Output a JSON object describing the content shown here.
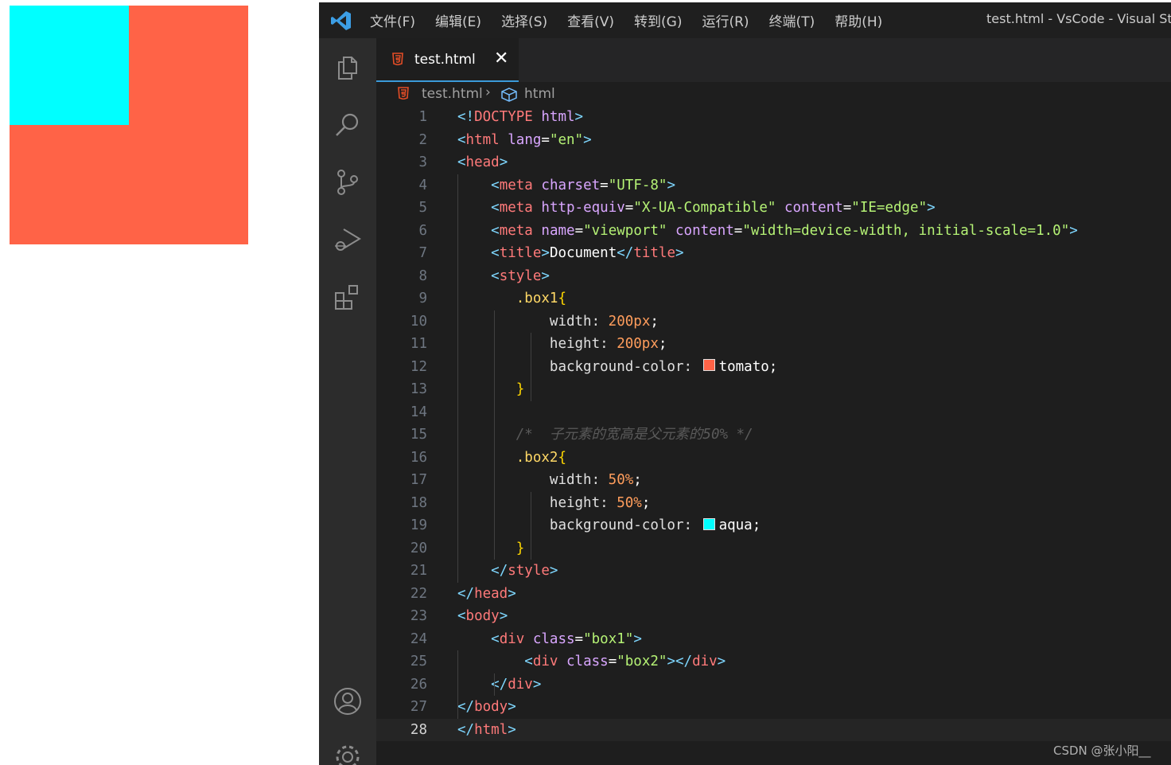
{
  "preview": {
    "box1_color": "#ff6347",
    "box2_color": "#00ffff"
  },
  "titlebar": {
    "logo_icon": "vscode-logo-icon",
    "menus": [
      "文件(F)",
      "编辑(E)",
      "选择(S)",
      "查看(V)",
      "转到(G)",
      "运行(R)",
      "终端(T)",
      "帮助(H)"
    ],
    "window_title": "test.html - VsCode - Visual St"
  },
  "activity_bar": {
    "icons": [
      "explorer-icon",
      "search-icon",
      "source-control-icon",
      "run-debug-icon",
      "extensions-icon",
      "accounts-icon",
      "settings-gear-icon"
    ]
  },
  "tab": {
    "label": "test.html",
    "close": "✕"
  },
  "breadcrumb": {
    "file": "test.html",
    "separator": "›",
    "symbol": "html"
  },
  "editor": {
    "current_line": 28,
    "lines": [
      {
        "n": "1"
      },
      {
        "n": "2"
      },
      {
        "n": "3"
      },
      {
        "n": "4"
      },
      {
        "n": "5"
      },
      {
        "n": "6"
      },
      {
        "n": "7"
      },
      {
        "n": "8"
      },
      {
        "n": "9"
      },
      {
        "n": "10"
      },
      {
        "n": "11"
      },
      {
        "n": "12"
      },
      {
        "n": "13"
      },
      {
        "n": "14"
      },
      {
        "n": "15"
      },
      {
        "n": "16"
      },
      {
        "n": "17"
      },
      {
        "n": "18"
      },
      {
        "n": "19"
      },
      {
        "n": "20"
      },
      {
        "n": "21"
      },
      {
        "n": "22"
      },
      {
        "n": "23"
      },
      {
        "n": "24"
      },
      {
        "n": "25"
      },
      {
        "n": "26"
      },
      {
        "n": "27"
      },
      {
        "n": "28"
      }
    ],
    "code": [
      [
        [
          "punct",
          "<!"
        ],
        [
          "doctype",
          "DOCTYPE"
        ],
        [
          "text",
          " "
        ],
        [
          "attr",
          "html"
        ],
        [
          "punct",
          ">"
        ]
      ],
      [
        [
          "punct",
          "<"
        ],
        [
          "tag",
          "html"
        ],
        [
          "text",
          " "
        ],
        [
          "attr",
          "lang"
        ],
        [
          "text",
          "="
        ],
        [
          "str",
          "\"en\""
        ],
        [
          "punct",
          ">"
        ]
      ],
      [
        [
          "punct",
          "<"
        ],
        [
          "tag",
          "head"
        ],
        [
          "punct",
          ">"
        ]
      ],
      [
        [
          "text",
          "    "
        ],
        [
          "punct",
          "<"
        ],
        [
          "tag",
          "meta"
        ],
        [
          "text",
          " "
        ],
        [
          "attr",
          "charset"
        ],
        [
          "text",
          "="
        ],
        [
          "str",
          "\"UTF-8\""
        ],
        [
          "punct",
          ">"
        ]
      ],
      [
        [
          "text",
          "    "
        ],
        [
          "punct",
          "<"
        ],
        [
          "tag",
          "meta"
        ],
        [
          "text",
          " "
        ],
        [
          "attr",
          "http-equiv"
        ],
        [
          "text",
          "="
        ],
        [
          "str",
          "\"X-UA-Compatible\""
        ],
        [
          "text",
          " "
        ],
        [
          "attr",
          "content"
        ],
        [
          "text",
          "="
        ],
        [
          "str",
          "\"IE=edge\""
        ],
        [
          "punct",
          ">"
        ]
      ],
      [
        [
          "text",
          "    "
        ],
        [
          "punct",
          "<"
        ],
        [
          "tag",
          "meta"
        ],
        [
          "text",
          " "
        ],
        [
          "attr",
          "name"
        ],
        [
          "text",
          "="
        ],
        [
          "str",
          "\"viewport\""
        ],
        [
          "text",
          " "
        ],
        [
          "attr",
          "content"
        ],
        [
          "text",
          "="
        ],
        [
          "str",
          "\"width=device-width, initial-scale=1.0\""
        ],
        [
          "punct",
          ">"
        ]
      ],
      [
        [
          "text",
          "    "
        ],
        [
          "punct",
          "<"
        ],
        [
          "tag",
          "title"
        ],
        [
          "punct",
          ">"
        ],
        [
          "text",
          "Document"
        ],
        [
          "punct",
          "</"
        ],
        [
          "tag",
          "title"
        ],
        [
          "punct",
          ">"
        ]
      ],
      [
        [
          "text",
          "    "
        ],
        [
          "punct",
          "<"
        ],
        [
          "tag",
          "style"
        ],
        [
          "punct",
          ">"
        ]
      ],
      [
        [
          "text",
          "       "
        ],
        [
          "sel",
          ".box1"
        ],
        [
          "brace",
          "{"
        ]
      ],
      [
        [
          "text",
          "           "
        ],
        [
          "prop",
          "width: "
        ],
        [
          "num",
          "200px"
        ],
        [
          "text",
          ";"
        ]
      ],
      [
        [
          "text",
          "           "
        ],
        [
          "prop",
          "height: "
        ],
        [
          "num",
          "200px"
        ],
        [
          "text",
          ";"
        ]
      ],
      [
        [
          "text",
          "           "
        ],
        [
          "prop",
          "background-color: "
        ],
        [
          "swatch",
          "#ff6347"
        ],
        [
          "val",
          "tomato"
        ],
        [
          "text",
          ";"
        ]
      ],
      [
        [
          "text",
          "       "
        ],
        [
          "brace",
          "}"
        ]
      ],
      [],
      [
        [
          "text",
          "       "
        ],
        [
          "comment",
          "/*  子元素的宽高是父元素的50% */"
        ]
      ],
      [
        [
          "text",
          "       "
        ],
        [
          "sel",
          ".box2"
        ],
        [
          "brace",
          "{"
        ]
      ],
      [
        [
          "text",
          "           "
        ],
        [
          "prop",
          "width: "
        ],
        [
          "num",
          "50%"
        ],
        [
          "text",
          ";"
        ]
      ],
      [
        [
          "text",
          "           "
        ],
        [
          "prop",
          "height: "
        ],
        [
          "num",
          "50%"
        ],
        [
          "text",
          ";"
        ]
      ],
      [
        [
          "text",
          "           "
        ],
        [
          "prop",
          "background-color: "
        ],
        [
          "swatch",
          "#00ffff"
        ],
        [
          "val",
          "aqua"
        ],
        [
          "text",
          ";"
        ]
      ],
      [
        [
          "text",
          "       "
        ],
        [
          "brace",
          "}"
        ]
      ],
      [
        [
          "text",
          "    "
        ],
        [
          "punct",
          "</"
        ],
        [
          "tag",
          "style"
        ],
        [
          "punct",
          ">"
        ]
      ],
      [
        [
          "punct",
          "</"
        ],
        [
          "tag",
          "head"
        ],
        [
          "punct",
          ">"
        ]
      ],
      [
        [
          "punct",
          "<"
        ],
        [
          "tag",
          "body"
        ],
        [
          "punct",
          ">"
        ]
      ],
      [
        [
          "text",
          "    "
        ],
        [
          "punct",
          "<"
        ],
        [
          "tag",
          "div"
        ],
        [
          "text",
          " "
        ],
        [
          "attr",
          "class"
        ],
        [
          "text",
          "="
        ],
        [
          "str",
          "\"box1\""
        ],
        [
          "punct",
          ">"
        ]
      ],
      [
        [
          "text",
          "        "
        ],
        [
          "punct",
          "<"
        ],
        [
          "tag",
          "div"
        ],
        [
          "text",
          " "
        ],
        [
          "attr",
          "class"
        ],
        [
          "text",
          "="
        ],
        [
          "str",
          "\"box2\""
        ],
        [
          "punct",
          "></"
        ],
        [
          "tag",
          "div"
        ],
        [
          "punct",
          ">"
        ]
      ],
      [
        [
          "text",
          "    "
        ],
        [
          "punct",
          "</"
        ],
        [
          "tag",
          "div"
        ],
        [
          "punct",
          ">"
        ]
      ],
      [
        [
          "punct",
          "</"
        ],
        [
          "tag",
          "body"
        ],
        [
          "punct",
          ">"
        ]
      ],
      [
        [
          "punct",
          "</"
        ],
        [
          "tag",
          "html"
        ],
        [
          "punct",
          ">"
        ]
      ]
    ]
  },
  "watermark": "CSDN @张小阳__"
}
